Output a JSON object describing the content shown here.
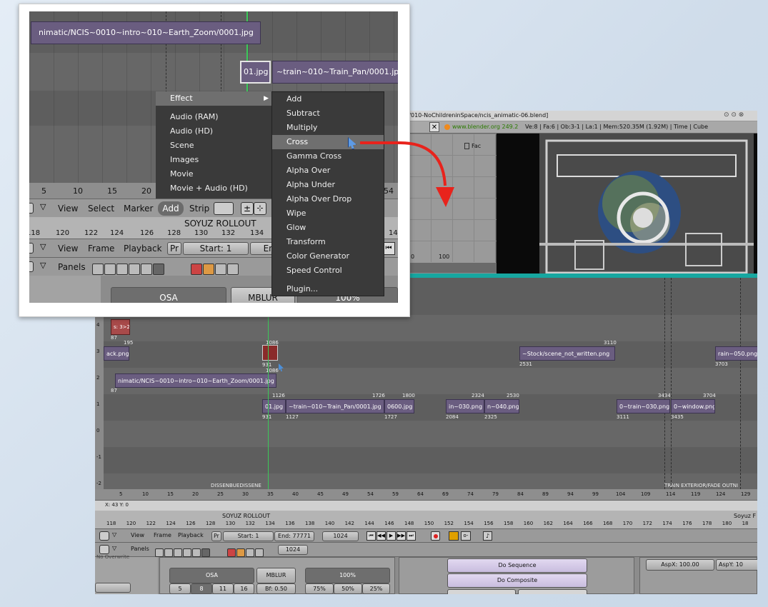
{
  "titlebar": {
    "path": "r/010-NoChildreninSpace/ncis_animatic-06.blend]"
  },
  "infobar": {
    "url": "www.blender.org 249.2",
    "stats": "Ve:8 | Fa:6 | Ob:3-1 | La:1  | Mem:520.35M (1.92M)  | Time  | Cube"
  },
  "ipo": {
    "fac": "Fac",
    "ticks": [
      "0",
      "100"
    ]
  },
  "sequencer": {
    "channels": [
      "4",
      "3",
      "2",
      "1",
      "0",
      "-1",
      "-2"
    ],
    "strips": [
      {
        "label": "s: 3>2",
        "start": "87"
      },
      {
        "label": "ack.png",
        "start": "",
        "end": "195"
      },
      {
        "label": "",
        "start": "931",
        "end": "1086",
        "end2": "1086"
      },
      {
        "label": "~Stock/scene_not_written.png",
        "start": "2531",
        "end": "3110"
      },
      {
        "label": "rain~050.png",
        "start": "3703"
      },
      {
        "label": "nimatic/NCIS~0010~intro~010~Earth_Zoom/0001.jpg",
        "start": "87"
      },
      {
        "label": "01.jpg",
        "start": "931",
        "end": "1126"
      },
      {
        "label": "~train~010~Train_Pan/0001.jpg",
        "start": "1127",
        "end": "1726"
      },
      {
        "label": "0600.jpg",
        "start": "1727",
        "end": "1800"
      },
      {
        "label": "in~030.png",
        "start": "2084"
      },
      {
        "label": "n~040.png",
        "start": "2325",
        "end": "2324",
        "end2": "2530"
      },
      {
        "label": "0~train~030.png",
        "start": "3111",
        "end": "3434"
      },
      {
        "label": "0~window.png",
        "start": "3435",
        "end": "3704"
      }
    ],
    "markers": [
      "DISSENBUEDISSENE",
      "TRAIN EXTERIOR/FADE OUTNI"
    ],
    "ruler": [
      "5",
      "10",
      "15",
      "20",
      "25",
      "30",
      "35",
      "40",
      "45",
      "49",
      "54",
      "59",
      "64",
      "69",
      "74",
      "79",
      "84",
      "89",
      "94",
      "99",
      "104",
      "109",
      "114",
      "119",
      "124",
      "129"
    ],
    "cursor_readout": "X: 43   Y: 0"
  },
  "timeline": {
    "marker_left": "SOYUZ ROLLOUT",
    "marker_right": "Soyuz F",
    "ticks": [
      "118",
      "120",
      "122",
      "124",
      "126",
      "128",
      "130",
      "132",
      "134",
      "136",
      "138",
      "140",
      "142",
      "144",
      "146",
      "148",
      "150",
      "152",
      "154",
      "156",
      "158",
      "160",
      "162",
      "164",
      "166",
      "168",
      "170",
      "172",
      "174",
      "176",
      "178",
      "180",
      "18"
    ],
    "menu": [
      "View",
      "Frame",
      "Playback"
    ],
    "pr": "Pr",
    "start": "Start: 1",
    "end": "End: 77771",
    "current": "1024"
  },
  "buttons_header": {
    "panels": "Panels",
    "current": "1024"
  },
  "render": {
    "osa": "OSA",
    "osa_values": [
      "5",
      "8",
      "11",
      "16"
    ],
    "mblur": "MBLUR",
    "bf": "Bf: 0.50",
    "percent": "100%",
    "percent_values": [
      "75%",
      "50%",
      "25%"
    ],
    "no_overwrite": "No Overwrite",
    "do_sequence": "Do Sequence",
    "do_composite": "Do Composite",
    "aspx": "AspX: 100.00",
    "aspy": "AspY: 10"
  },
  "zoom": {
    "strip_top": "nimatic/NCIS~0010~intro~010~Earth_Zoom/0001.jpg",
    "strip_small": "01.jpg",
    "strip_train": "~train~010~Train_Pan/0001.jp",
    "ruler": [
      "5",
      "10",
      "15",
      "20",
      "54"
    ],
    "header_menu": [
      "View",
      "Select",
      "Marker",
      "Add",
      "Strip"
    ],
    "marker": "SOYUZ ROLLOUT",
    "ticks": [
      "118",
      "120",
      "122",
      "124",
      "126",
      "128",
      "130",
      "132",
      "134",
      "14"
    ],
    "tl_menu": [
      "View",
      "Frame",
      "Playback"
    ],
    "pr": "Pr",
    "start": "Start: 1",
    "end": "End",
    "panels": "Panels",
    "osa": "OSA",
    "mblur": "MBLUR",
    "percent": "100%",
    "menu_left": [
      "Effect",
      "Audio (RAM)",
      "Audio (HD)",
      "Scene",
      "Images",
      "Movie",
      "Movie + Audio (HD)"
    ],
    "menu_right": [
      "Add",
      "Subtract",
      "Multiply",
      "Cross",
      "Gamma Cross",
      "Alpha Over",
      "Alpha Under",
      "Alpha Over Drop",
      "Wipe",
      "Glow",
      "Transform",
      "Color Generator",
      "Speed Control",
      "Plugin..."
    ],
    "highlighted": "Cross"
  },
  "colors": {
    "arrow": "#e8231c",
    "strip": "#6a5d80",
    "selected_strip": "#8a2a2a",
    "cursor": "#3cc85a"
  }
}
